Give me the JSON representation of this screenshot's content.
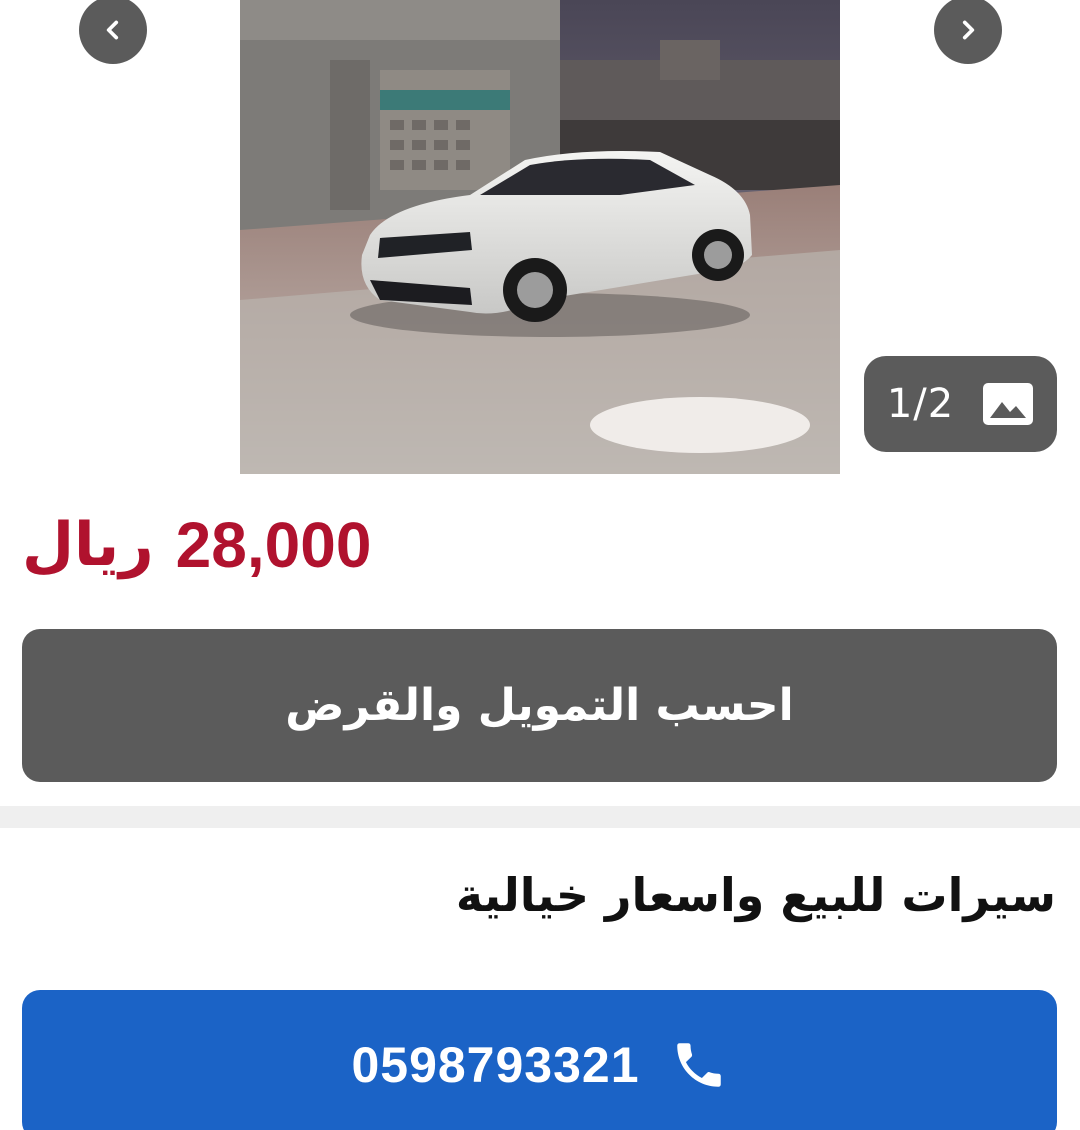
{
  "carousel": {
    "counter": "1/2",
    "prev_icon": "chevron-left-icon",
    "next_icon": "chevron-right-icon",
    "gallery_icon": "image-icon"
  },
  "listing": {
    "price_value": "28,000",
    "price_currency": "ريال",
    "title": "سيرات للبيع واسعار خيالية"
  },
  "actions": {
    "finance_label": "احسب التمويل والقرض",
    "phone_number": "0598793321",
    "phone_icon": "phone-icon"
  },
  "colors": {
    "price": "#b0122e",
    "dark_button": "#5b5b5b",
    "call_button": "#1b63c6"
  }
}
